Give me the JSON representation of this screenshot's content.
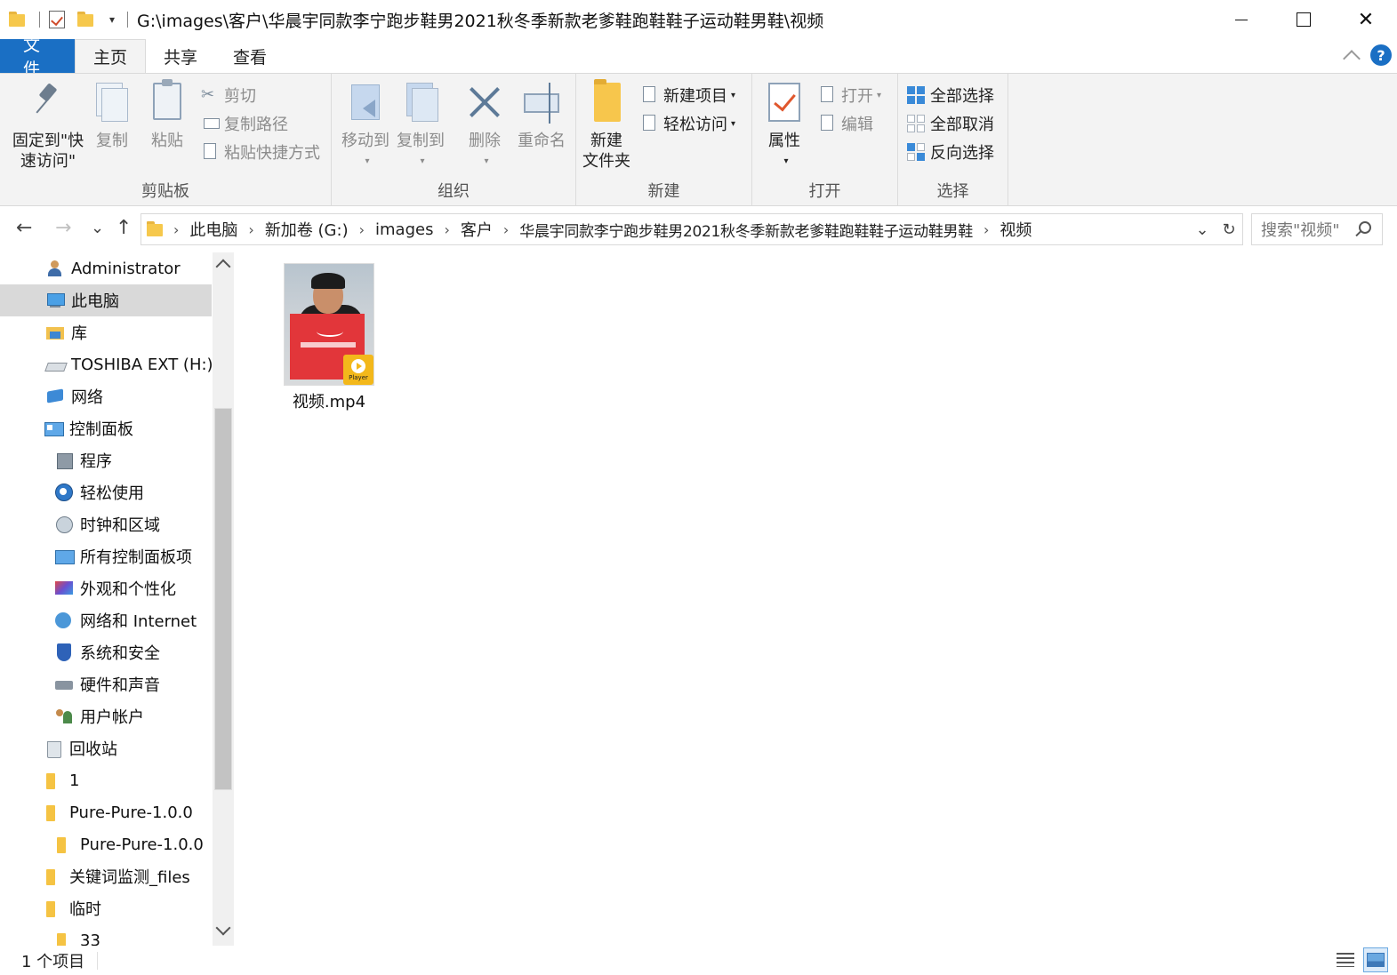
{
  "window": {
    "title_path": "G:\\images\\客户\\华晨宇同款李宁跑步鞋男2021秋冬季新款老爹鞋跑鞋鞋子运动鞋男鞋\\视频",
    "controls": {
      "minimize": "—",
      "maximize": "☐",
      "close": "✕"
    },
    "qat_dropdown": "▾"
  },
  "ribbon_tabs": [
    {
      "label": "文件"
    },
    {
      "label": "主页"
    },
    {
      "label": "共享"
    },
    {
      "label": "查看"
    }
  ],
  "help_label": "?",
  "ribbon": {
    "clipboard": {
      "label": "剪贴板",
      "pin_line1": "固定到\"快",
      "pin_line2": "速访问\"",
      "copy": "复制",
      "paste": "粘贴",
      "cut": "剪切",
      "copy_path": "复制路径",
      "paste_shortcut": "粘贴快捷方式"
    },
    "organize": {
      "label": "组织",
      "move_to": "移动到",
      "copy_to": "复制到",
      "delete": "删除",
      "rename": "重命名"
    },
    "new": {
      "label": "新建",
      "new_folder_line1": "新建",
      "new_folder_line2": "文件夹",
      "new_item": "新建项目",
      "easy_access": "轻松访问"
    },
    "open": {
      "label": "打开",
      "properties": "属性",
      "open": "打开",
      "edit": "编辑"
    },
    "select": {
      "label": "选择",
      "select_all": "全部选择",
      "select_none": "全部取消",
      "invert": "反向选择"
    }
  },
  "nav_buttons": {
    "back": "←",
    "forward": "→",
    "recent": "⌄",
    "up": "↑"
  },
  "breadcrumbs": [
    "此电脑",
    "新加卷 (G:)",
    "images",
    "客户",
    "华晨宇同款李宁跑步鞋男2021秋冬季新款老爹鞋跑鞋鞋子运动鞋男鞋",
    "视频"
  ],
  "breadcrumb_separator": "›",
  "address_end": {
    "dropdown": "⌄",
    "refresh": "↻"
  },
  "search": {
    "placeholder": "搜索\"视频\""
  },
  "nav_pane": [
    {
      "label": "Administrator",
      "icon": "user-icon"
    },
    {
      "label": "此电脑",
      "icon": "this-pc-icon",
      "selected": true
    },
    {
      "label": "库",
      "icon": "library-icon"
    },
    {
      "label": "TOSHIBA EXT (H:)",
      "icon": "drive-icon"
    },
    {
      "label": "网络",
      "icon": "network-icon"
    },
    {
      "label": "控制面板",
      "icon": "control-panel-icon"
    },
    {
      "label": "程序",
      "icon": "programs-icon"
    },
    {
      "label": "轻松使用",
      "icon": "ease-of-access-icon"
    },
    {
      "label": "时钟和区域",
      "icon": "clock-icon"
    },
    {
      "label": "所有控制面板项",
      "icon": "all-items-icon"
    },
    {
      "label": "外观和个性化",
      "icon": "appearance-icon"
    },
    {
      "label": "网络和 Internet",
      "icon": "network-internet-icon"
    },
    {
      "label": "系统和安全",
      "icon": "security-icon"
    },
    {
      "label": "硬件和声音",
      "icon": "hardware-icon"
    },
    {
      "label": "用户帐户",
      "icon": "user-accounts-icon"
    },
    {
      "label": "回收站",
      "icon": "recycle-bin-icon"
    },
    {
      "label": "1",
      "icon": "folder-icon"
    },
    {
      "label": "Pure-Pure-1.0.0",
      "icon": "folder-icon"
    },
    {
      "label": "Pure-Pure-1.0.0",
      "icon": "folder-icon"
    },
    {
      "label": "关键词监测_files",
      "icon": "folder-icon"
    },
    {
      "label": "临时",
      "icon": "folder-icon"
    },
    {
      "label": "33",
      "icon": "folder-icon"
    }
  ],
  "files": [
    {
      "name": "视频.mp4",
      "badge_text": "Player"
    }
  ],
  "status": {
    "count": "1 个项目"
  },
  "colors": {
    "accent": "#1a6fc4",
    "selected_nav": "#d9d9d9",
    "ribbon_bg": "#f3f3f3"
  }
}
